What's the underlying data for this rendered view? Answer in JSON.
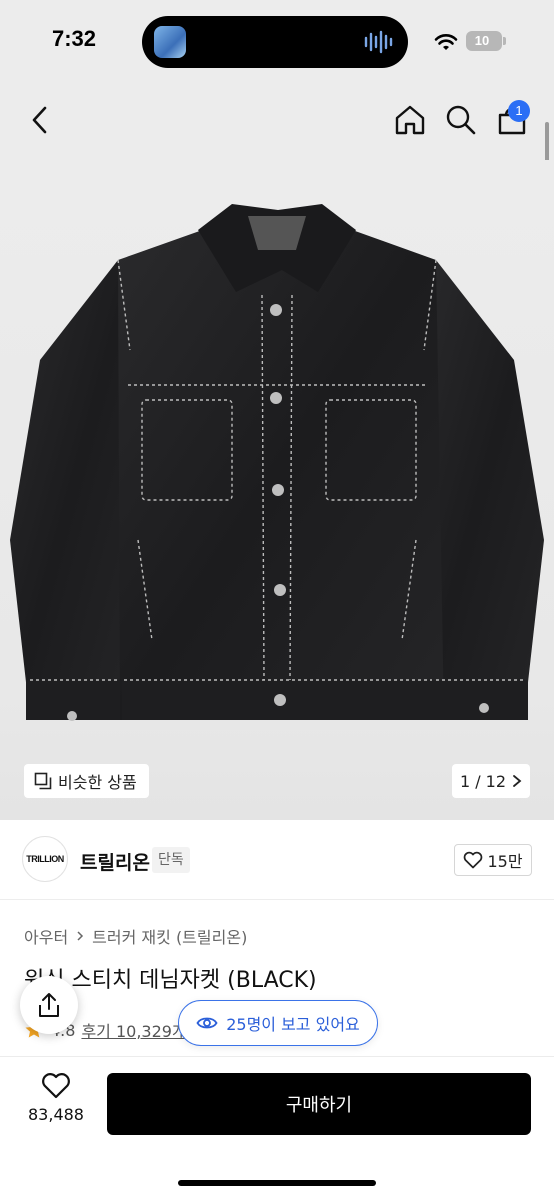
{
  "status_bar": {
    "time": "7:32",
    "battery": "10"
  },
  "header": {
    "cart_count": "1",
    "back_icon": "chevron-left-icon",
    "home_icon": "home-icon",
    "search_icon": "search-icon",
    "cart_icon": "shopping-bag-icon"
  },
  "gallery": {
    "similar_label": "비슷한 상품",
    "page_counter": "1 / 12"
  },
  "brand": {
    "logo_text": "TRILLION",
    "name": "트릴리온",
    "badge": "단독",
    "likes": "15만"
  },
  "product": {
    "breadcrumb": [
      "아우터",
      "트러커 재킷 (트릴리온)"
    ],
    "title": "워싱 스티치 데님자켓 (BLACK)",
    "rating": "4.8",
    "reviews": "후기 10,329개"
  },
  "viewer_toast": "25명이 보고 있어요",
  "bottom": {
    "wish_count": "83,488",
    "buy_label": "구매하기"
  },
  "colors": {
    "accent": "#2b6ef5",
    "toast": "#3b73e8",
    "buy": "#000000",
    "star": "#f5a623"
  }
}
